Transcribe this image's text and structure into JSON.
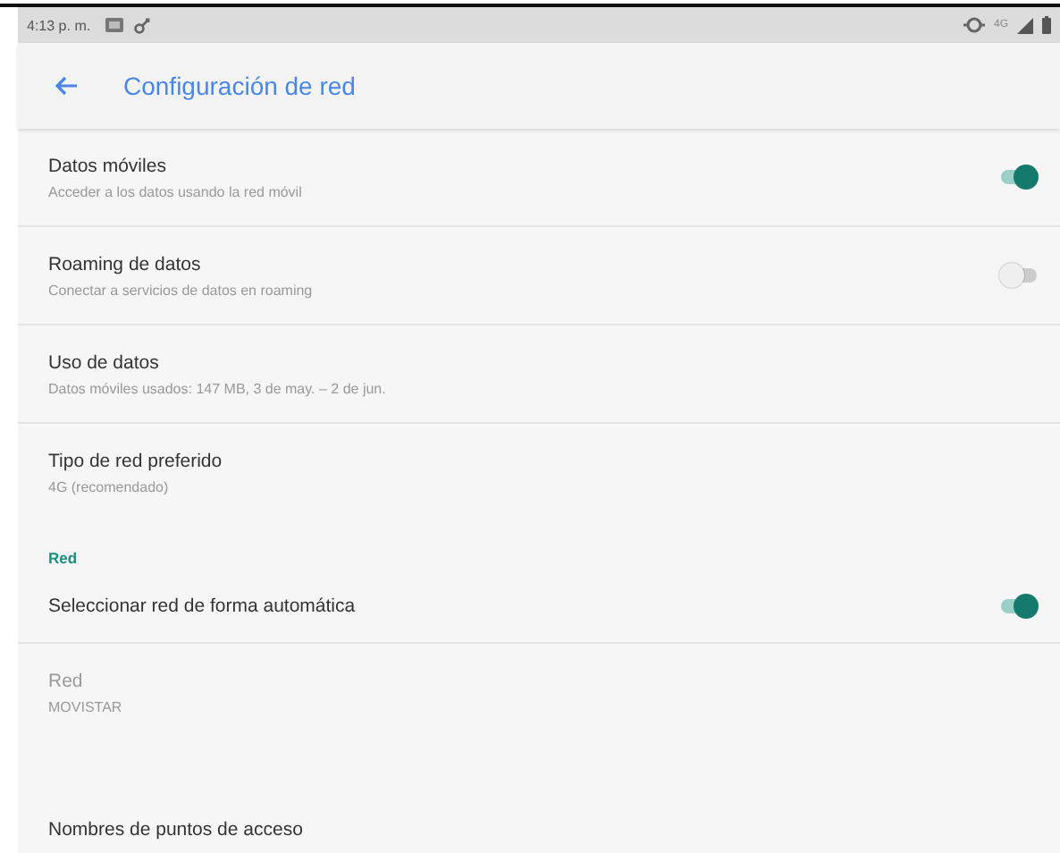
{
  "status_bar": {
    "time": "4:13 p. m.",
    "network_type": "4G"
  },
  "toolbar": {
    "title": "Configuración de red"
  },
  "items": [
    {
      "kind": "switch",
      "title": "Datos móviles",
      "summary": "Acceder a los datos usando la red móvil",
      "on": true,
      "disabled": false
    },
    {
      "kind": "switch",
      "title": "Roaming de datos",
      "summary": "Conectar a servicios de datos en roaming",
      "on": false,
      "disabled": false
    },
    {
      "kind": "text",
      "title": "Uso de datos",
      "summary": "Datos móviles usados: 147 MB, 3 de may. – 2 de jun.",
      "disabled": false
    },
    {
      "kind": "text",
      "title": "Tipo de red preferido",
      "summary": "4G (recomendado)",
      "disabled": false
    },
    {
      "kind": "header",
      "title": "Red"
    },
    {
      "kind": "switch",
      "title": "Seleccionar red de forma automática",
      "on": true,
      "disabled": false
    },
    {
      "kind": "text",
      "title": "Red",
      "summary": "MOVISTAR",
      "disabled": true
    },
    {
      "kind": "text",
      "title": "Nombres de puntos de acceso",
      "disabled": false
    }
  ]
}
